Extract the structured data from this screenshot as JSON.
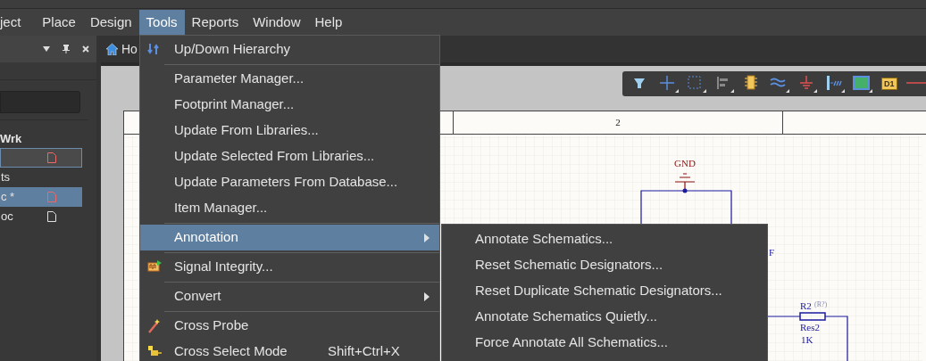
{
  "menubar": [
    {
      "label": "ject",
      "selected": false
    },
    {
      "label": "Place",
      "selected": false
    },
    {
      "label": "Design",
      "selected": false
    },
    {
      "label": "Tools",
      "selected": true
    },
    {
      "label": "Reports",
      "selected": false
    },
    {
      "label": "Window",
      "selected": false
    },
    {
      "label": "Help",
      "selected": false
    }
  ],
  "panel": {
    "project": "Wrk",
    "rows": [
      {
        "focused": true,
        "selected": false,
        "color": "#e86a6a"
      },
      {
        "label": "ts",
        "focused": false,
        "selected": false
      },
      {
        "label": "c *",
        "focused": false,
        "selected": true,
        "color": "#e86a6a"
      },
      {
        "label": "oc",
        "focused": false,
        "selected": false,
        "color": "#e0e0e0"
      }
    ]
  },
  "tab": {
    "label": "Ho"
  },
  "toolbar": {
    "part_label": "D1"
  },
  "sheet": {
    "column_label": "2",
    "ground_label": "GND",
    "fragment": "F",
    "resistor": {
      "designator": "R2",
      "placeholder": "(R?)",
      "comment": "Res2",
      "value": "1K"
    }
  },
  "menu": [
    {
      "kind": "item",
      "label": "Up/Down Hierarchy",
      "selected": false,
      "has_submenu": false
    },
    {
      "kind": "separator"
    },
    {
      "kind": "item",
      "label": "Parameter Manager...",
      "selected": false,
      "has_submenu": false
    },
    {
      "kind": "item",
      "label": "Footprint Manager...",
      "selected": false,
      "has_submenu": false
    },
    {
      "kind": "item",
      "label": "Update From Libraries...",
      "selected": false,
      "has_submenu": false
    },
    {
      "kind": "item",
      "label": "Update Selected From Libraries...",
      "selected": false,
      "has_submenu": false
    },
    {
      "kind": "item",
      "label": "Update Parameters From Database...",
      "selected": false,
      "has_submenu": false
    },
    {
      "kind": "item",
      "label": "Item Manager...",
      "selected": false,
      "has_submenu": false
    },
    {
      "kind": "separator"
    },
    {
      "kind": "item",
      "label": "Annotation",
      "selected": true,
      "has_submenu": true
    },
    {
      "kind": "separator"
    },
    {
      "kind": "item",
      "label": "Signal Integrity...",
      "selected": false,
      "has_submenu": false
    },
    {
      "kind": "separator"
    },
    {
      "kind": "item",
      "label": "Convert",
      "selected": false,
      "has_submenu": true
    },
    {
      "kind": "separator"
    },
    {
      "kind": "item",
      "label": "Cross Probe",
      "selected": false,
      "has_submenu": false
    },
    {
      "kind": "item",
      "label": "Cross Select Mode",
      "shortcut": "Shift+Ctrl+X",
      "selected": false,
      "has_submenu": false
    }
  ],
  "submenu": [
    {
      "label": "Annotate Schematics..."
    },
    {
      "label": "Reset Schematic Designators..."
    },
    {
      "label": "Reset Duplicate Schematic Designators..."
    },
    {
      "label": "Annotate Schematics Quietly..."
    },
    {
      "label": "Force Annotate All Schematics..."
    }
  ]
}
